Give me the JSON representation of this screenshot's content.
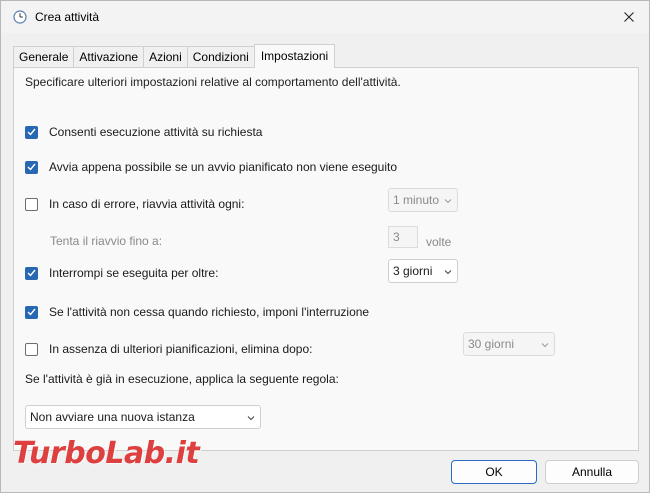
{
  "window": {
    "title": "Crea attività"
  },
  "tabs": [
    {
      "label": "Generale"
    },
    {
      "label": "Attivazione"
    },
    {
      "label": "Azioni"
    },
    {
      "label": "Condizioni"
    },
    {
      "label": "Impostazioni",
      "active": true
    }
  ],
  "panel": {
    "description": "Specificare ulteriori impostazioni relative al comportamento dell'attività.",
    "options": {
      "run_on_demand": {
        "label": "Consenti esecuzione attività su richiesta",
        "checked": true
      },
      "run_asap": {
        "label": "Avvia appena possibile se un avvio pianificato non viene eseguito",
        "checked": true
      },
      "restart_on_failure": {
        "label": "In caso di errore, riavvia attività ogni:",
        "checked": false,
        "value": "1 minuto"
      },
      "restart_attempts": {
        "label": "Tenta il riavvio fino a:",
        "value": "3",
        "unit": "volte"
      },
      "stop_if_longer": {
        "label": "Interrompi se eseguita per oltre:",
        "checked": true,
        "value": "3 giorni"
      },
      "force_stop": {
        "label": "Se l'attività non cessa quando richiesto, imponi l'interruzione",
        "checked": true
      },
      "delete_if_not_scheduled": {
        "label": "In assenza di ulteriori pianificazioni, elimina dopo:",
        "checked": false,
        "value": "30 giorni"
      }
    },
    "rule_label": "Se l'attività è già in esecuzione, applica la seguente regola:",
    "rule_value": "Non avviare una nuova istanza"
  },
  "buttons": {
    "ok": "OK",
    "cancel": "Annulla"
  },
  "watermark": "TurboLab.it",
  "colors": {
    "accent": "#2867b2",
    "watermark": "#d81e1e"
  }
}
